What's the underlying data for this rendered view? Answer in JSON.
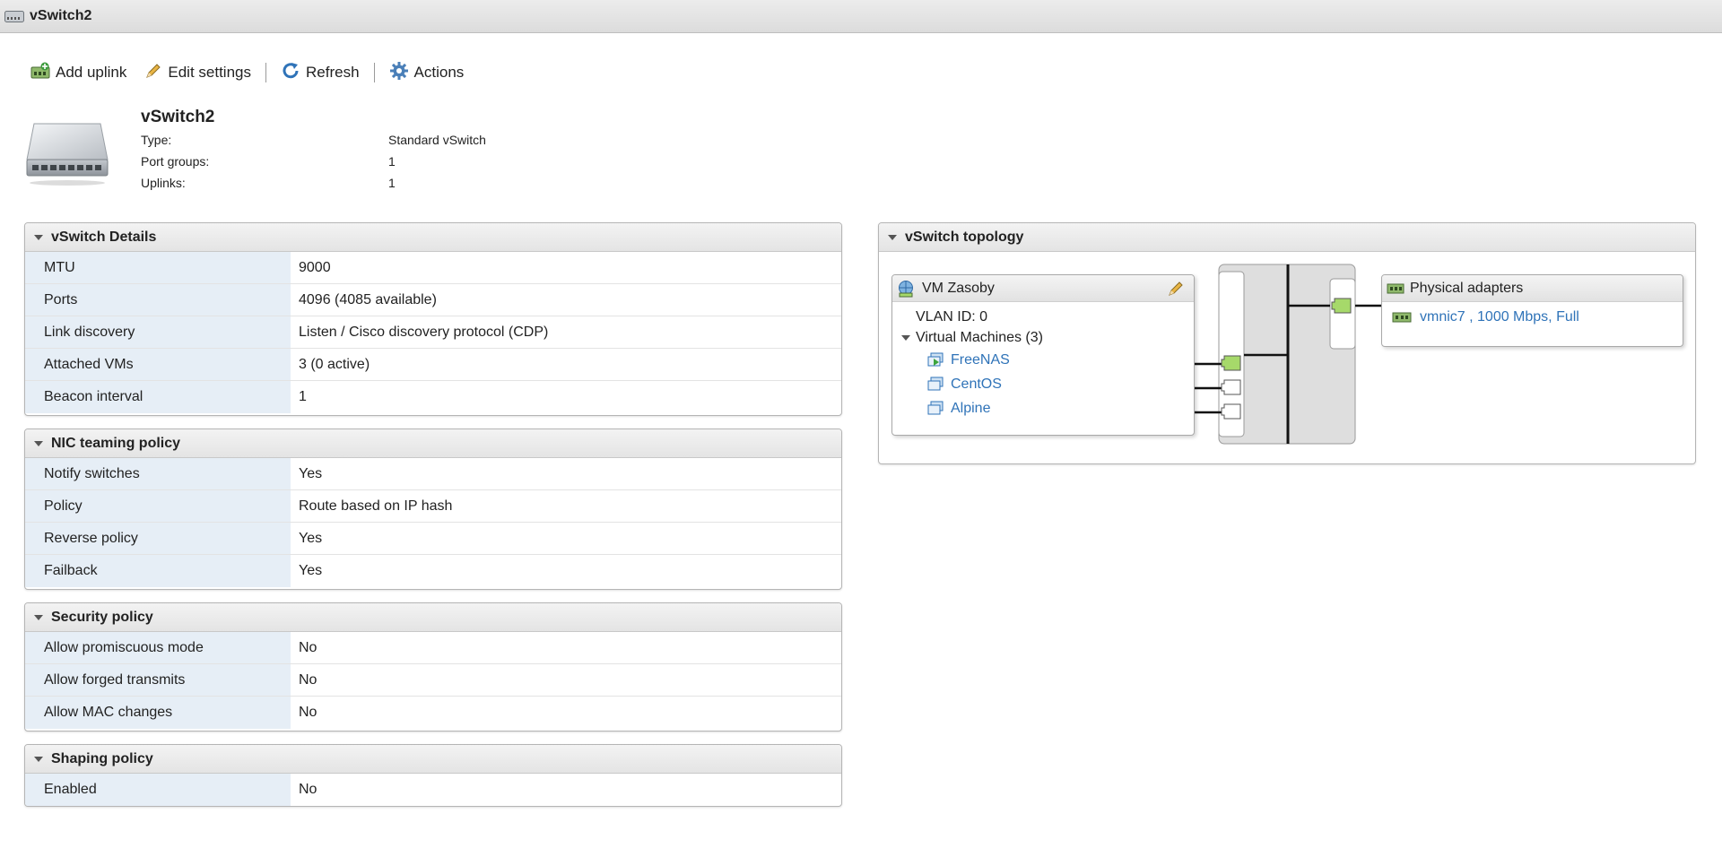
{
  "window": {
    "title": "vSwitch2"
  },
  "toolbar": {
    "add_uplink": "Add uplink",
    "edit_settings": "Edit settings",
    "refresh": "Refresh",
    "actions": "Actions"
  },
  "header": {
    "name": "vSwitch2",
    "fields": [
      {
        "label": "Type:",
        "value": "Standard vSwitch"
      },
      {
        "label": "Port groups:",
        "value": "1"
      },
      {
        "label": "Uplinks:",
        "value": "1"
      }
    ]
  },
  "details": {
    "title": "vSwitch Details",
    "rows": [
      {
        "label": "MTU",
        "value": "9000"
      },
      {
        "label": "Ports",
        "value": "4096 (4085 available)"
      },
      {
        "label": "Link discovery",
        "value": "Listen / Cisco discovery protocol (CDP)"
      },
      {
        "label": "Attached VMs",
        "value": "3 (0 active)"
      },
      {
        "label": "Beacon interval",
        "value": "1"
      }
    ]
  },
  "nic_teaming": {
    "title": "NIC teaming policy",
    "rows": [
      {
        "label": "Notify switches",
        "value": "Yes"
      },
      {
        "label": "Policy",
        "value": "Route based on IP hash"
      },
      {
        "label": "Reverse policy",
        "value": "Yes"
      },
      {
        "label": "Failback",
        "value": "Yes"
      }
    ]
  },
  "security": {
    "title": "Security policy",
    "rows": [
      {
        "label": "Allow promiscuous mode",
        "value": "No"
      },
      {
        "label": "Allow forged transmits",
        "value": "No"
      },
      {
        "label": "Allow MAC changes",
        "value": "No"
      }
    ]
  },
  "shaping": {
    "title": "Shaping policy",
    "rows": [
      {
        "label": "Enabled",
        "value": "No"
      }
    ]
  },
  "topology": {
    "title": "vSwitch topology",
    "portgroup": {
      "name": "VM Zasoby",
      "vlan": "VLAN ID: 0",
      "vms_label": "Virtual Machines (3)",
      "vms": [
        "FreeNAS",
        "CentOS",
        "Alpine"
      ]
    },
    "physical": {
      "title": "Physical adapters",
      "adapter": "vmnic7 , 1000 Mbps, Full"
    },
    "colors": {
      "active_port": "#a6d96a",
      "link": "#2f73b8"
    }
  }
}
